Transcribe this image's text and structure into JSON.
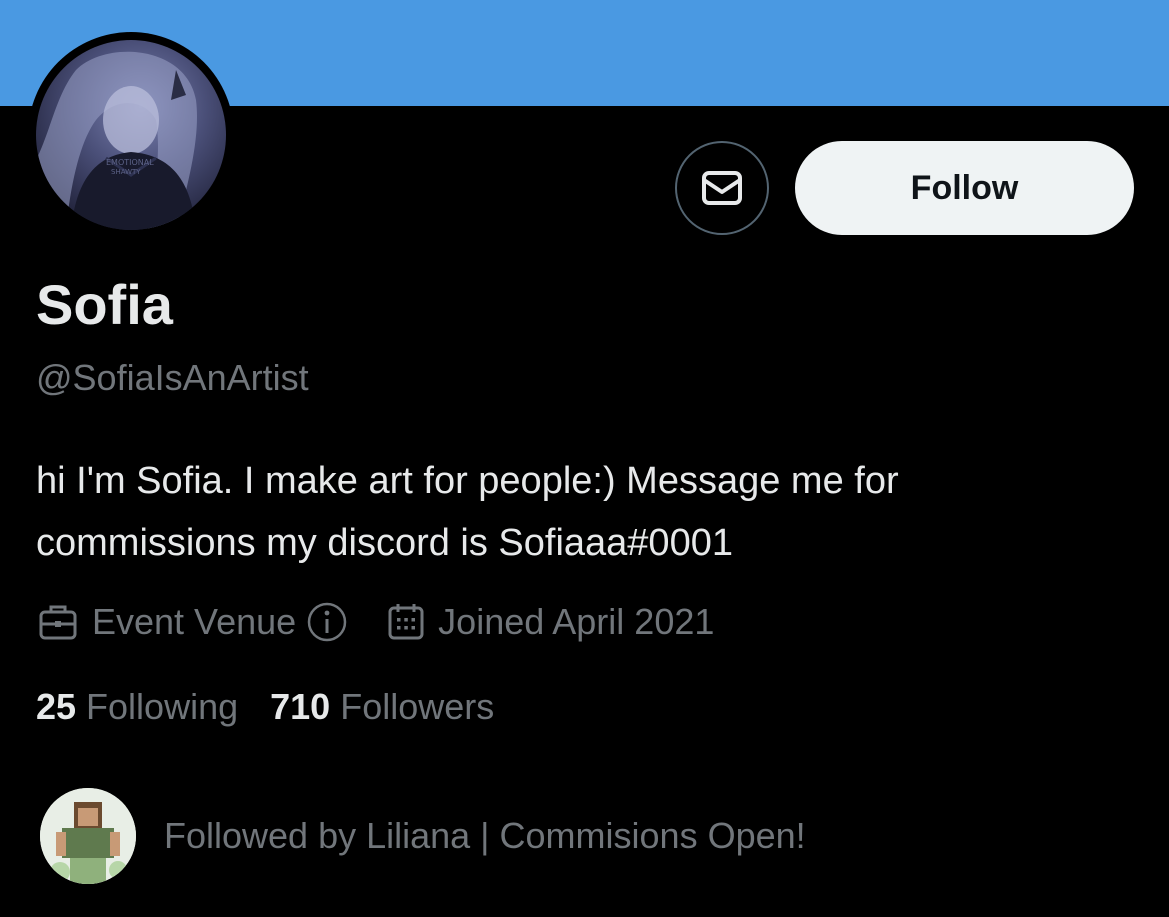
{
  "profile": {
    "display_name": "Sofia",
    "handle": "@SofiaIsAnArtist",
    "bio_line1": "hi I'm Sofia. I make art for people:) Message me for",
    "bio_line2": "commissions my discord is Sofiaaa#0001",
    "category": "Event Venue",
    "joined": "Joined April 2021"
  },
  "actions": {
    "follow_label": "Follow"
  },
  "stats": {
    "following_count": "25",
    "following_label": "Following",
    "followers_count": "710",
    "followers_label": "Followers"
  },
  "followed_by": {
    "text": "Followed by Liliana | Commisions Open!"
  },
  "icons": {
    "message": "envelope-icon",
    "category": "briefcase-icon",
    "info": "info-icon",
    "joined": "calendar-icon"
  },
  "colors": {
    "banner": "#4a99e2",
    "background": "#000000",
    "primary_text": "#e7e9ea",
    "secondary_text": "#71767b",
    "follow_button": "#eff3f4"
  }
}
